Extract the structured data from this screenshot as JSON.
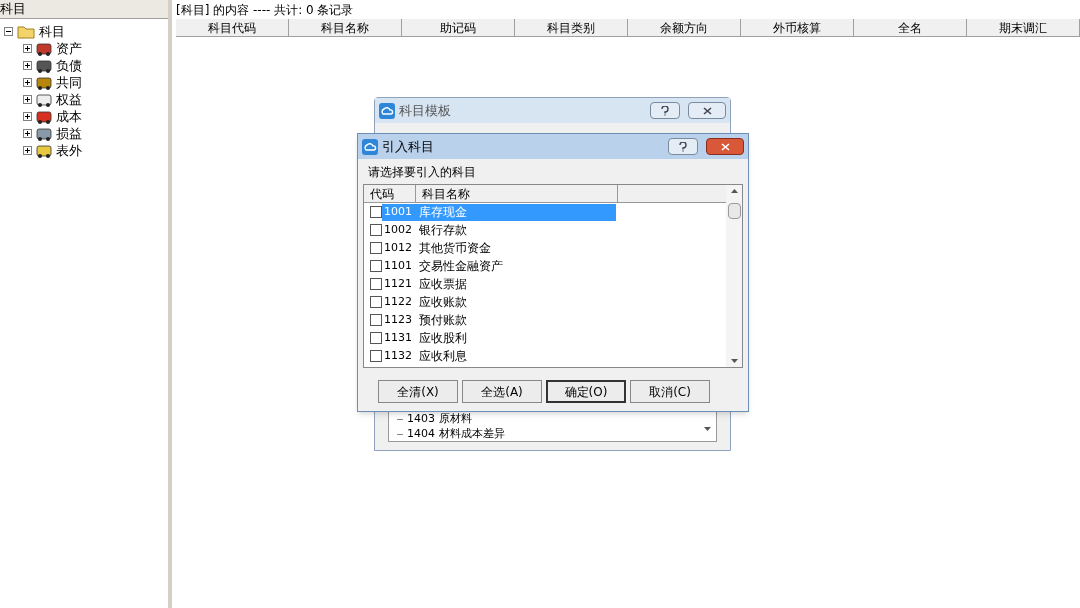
{
  "left_pane": {
    "title": "科目",
    "tree": {
      "label": "科目",
      "expanded": true,
      "children": [
        {
          "label": "资产",
          "expanded": false
        },
        {
          "label": "负债",
          "expanded": false
        },
        {
          "label": "共同",
          "expanded": false
        },
        {
          "label": "权益",
          "expanded": false
        },
        {
          "label": "成本",
          "expanded": false
        },
        {
          "label": "损益",
          "expanded": false
        },
        {
          "label": "表外",
          "expanded": false
        }
      ]
    }
  },
  "main": {
    "caption": "[科目] 的内容 ---- 共计: 0 条记录",
    "columns": [
      "科目代码",
      "科目名称",
      "助记码",
      "科目类别",
      "余额方向",
      "外币核算",
      "全名",
      "期末调汇"
    ]
  },
  "back_dialog": {
    "title": "科目模板",
    "tree_rows": [
      {
        "code": "1403",
        "name": "原材料"
      },
      {
        "code": "1404",
        "name": "材料成本差异"
      }
    ]
  },
  "dialog": {
    "title": "引入科目",
    "prompt": "请选择要引入的科目",
    "columns": [
      "代码",
      "科目名称"
    ],
    "rows": [
      {
        "code": "1001",
        "name": "库存现金",
        "checked": false,
        "selected": true
      },
      {
        "code": "1002",
        "name": "银行存款",
        "checked": false,
        "selected": false
      },
      {
        "code": "1012",
        "name": "其他货币资金",
        "checked": false,
        "selected": false
      },
      {
        "code": "1101",
        "name": "交易性金融资产",
        "checked": false,
        "selected": false
      },
      {
        "code": "1121",
        "name": "应收票据",
        "checked": false,
        "selected": false
      },
      {
        "code": "1122",
        "name": "应收账款",
        "checked": false,
        "selected": false
      },
      {
        "code": "1123",
        "name": "预付账款",
        "checked": false,
        "selected": false
      },
      {
        "code": "1131",
        "name": "应收股利",
        "checked": false,
        "selected": false
      },
      {
        "code": "1132",
        "name": "应收利息",
        "checked": false,
        "selected": false
      }
    ],
    "buttons": [
      "全清(X)",
      "全选(A)",
      "确定(O)",
      "取消(C)"
    ]
  }
}
